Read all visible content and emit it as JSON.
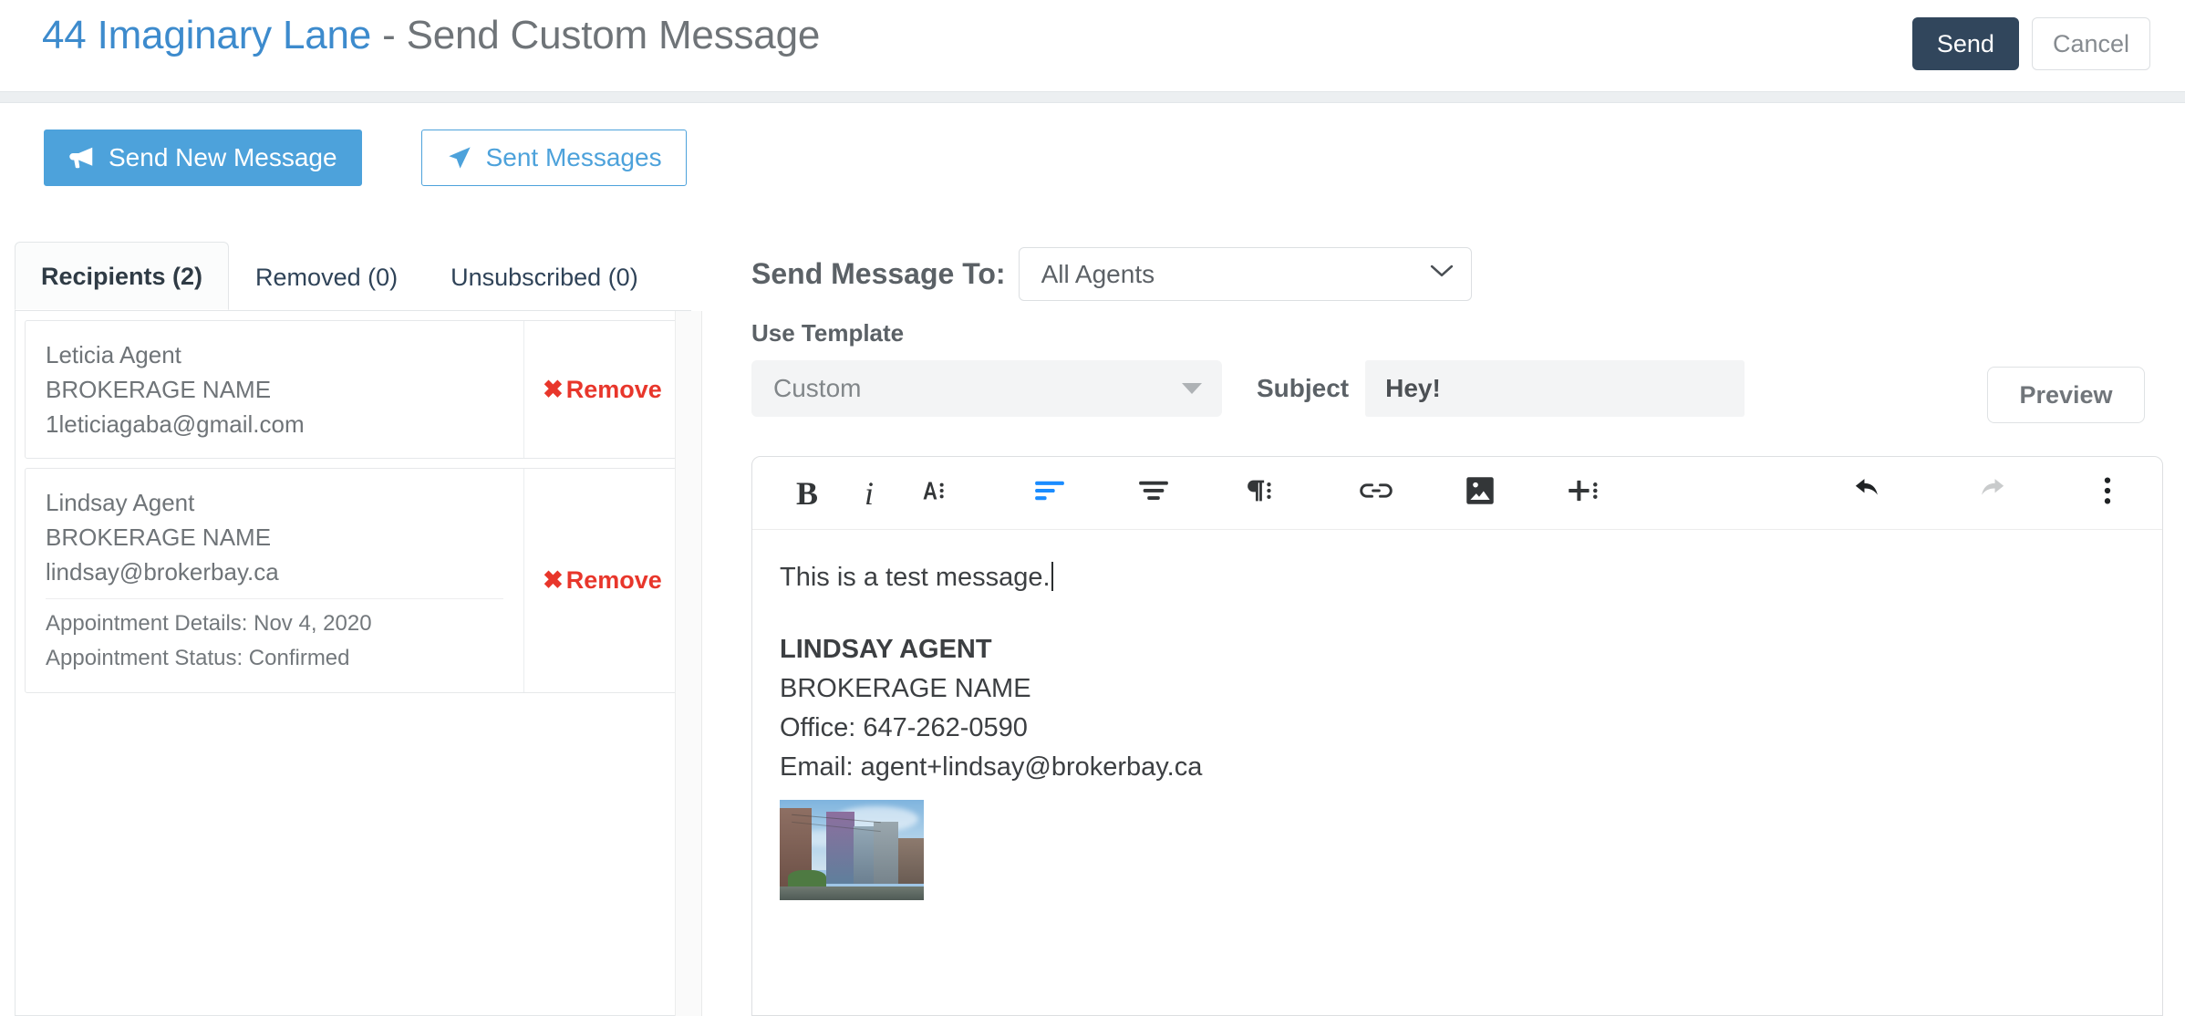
{
  "header": {
    "title_primary": "44 Imaginary Lane",
    "title_secondary": "- Send Custom Message",
    "send_label": "Send",
    "cancel_label": "Cancel"
  },
  "mode_buttons": {
    "send_new": "Send New Message",
    "sent": "Sent Messages"
  },
  "left_panel": {
    "tabs": [
      {
        "label": "Recipients (2)",
        "active": true
      },
      {
        "label": "Removed (0)",
        "active": false
      },
      {
        "label": "Unsubscribed (0)",
        "active": false
      }
    ],
    "recipients": [
      {
        "name": "Leticia Agent",
        "brokerage": "BROKERAGE NAME",
        "email": "1leticiagaba@gmail.com",
        "remove_label": "Remove",
        "remove_icon": "x-icon"
      },
      {
        "name": "Lindsay Agent",
        "brokerage": "BROKERAGE NAME",
        "email": "lindsay@brokerbay.ca",
        "appointment_details": "Appointment Details: Nov 4, 2020",
        "appointment_status": "Appointment Status: Confirmed",
        "remove_label": "Remove",
        "remove_icon": "x-icon"
      }
    ]
  },
  "compose": {
    "send_to_label": "Send Message To:",
    "recipient_group": "All Agents",
    "recipient_group_options": [
      "All Agents"
    ],
    "use_template_label": "Use Template",
    "template_value": "Custom",
    "subject_label": "Subject",
    "subject_value": "Hey!",
    "subject_placeholder": "Subject",
    "preview_label": "Preview"
  },
  "toolbar": {
    "bold": "B",
    "italic": "i",
    "font": "A",
    "align_left": "align-left",
    "align_center": "align-center",
    "paragraph": "¶",
    "link": "link",
    "image": "image",
    "insert": "+",
    "undo": "undo",
    "redo": "redo",
    "more": "more"
  },
  "message": {
    "body": "This is a test message.",
    "signature": {
      "name": "LINDSAY AGENT",
      "brokerage": "BROKERAGE NAME",
      "office": "Office: 647-262-0590",
      "email": "Email: agent+lindsay@brokerbay.ca",
      "image_alt": "city-skyline-photo"
    }
  },
  "colors": {
    "brand_blue": "#4da2db",
    "title_blue": "#3d8bcd",
    "send_navy": "#31465c",
    "danger_red": "#e8362b",
    "toolbar_active": "#1a8cff"
  }
}
